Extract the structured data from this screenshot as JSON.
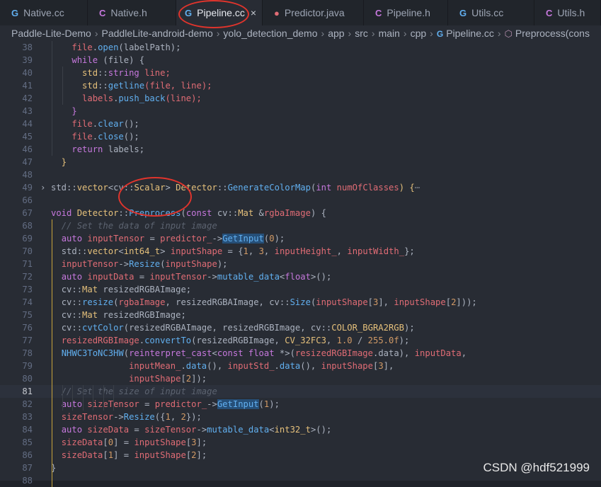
{
  "tabs": [
    {
      "label": "Native.cc",
      "icon": "G",
      "icon_color": "#61afef"
    },
    {
      "label": "Native.h",
      "icon": "C",
      "icon_color": "#c678dd"
    },
    {
      "label": "Pipeline.cc",
      "icon": "G",
      "icon_color": "#61afef",
      "close": "×"
    },
    {
      "label": "Predictor.java",
      "icon": "●",
      "icon_color": "#e06c75"
    },
    {
      "label": "Pipeline.h",
      "icon": "C",
      "icon_color": "#c678dd"
    },
    {
      "label": "Utils.cc",
      "icon": "G",
      "icon_color": "#61afef"
    },
    {
      "label": "Utils.h",
      "icon": "C",
      "icon_color": "#c678dd"
    }
  ],
  "breadcrumb": [
    "Paddle-Lite-Demo",
    "PaddleLite-android-demo",
    "yolo_detection_demo",
    "app",
    "src",
    "main",
    "cpp",
    "Pipeline.cc",
    "Preprocess(cons"
  ],
  "code_lines": [
    {
      "num": "38",
      "tokens": [
        [
          "    ",
          ""
        ],
        [
          "file",
          "v"
        ],
        [
          ".",
          "p"
        ],
        [
          "open",
          "f"
        ],
        [
          "(labelPath);",
          "p"
        ]
      ]
    },
    {
      "num": "39",
      "tokens": [
        [
          "    ",
          ""
        ],
        [
          "while",
          "k"
        ],
        [
          " (file) {",
          "p"
        ]
      ]
    },
    {
      "num": "40",
      "tokens": [
        [
          "      ",
          ""
        ],
        [
          "std",
          "t"
        ],
        [
          "::",
          "p"
        ],
        [
          "string",
          "k"
        ],
        [
          " line;",
          "v"
        ]
      ]
    },
    {
      "num": "41",
      "tokens": [
        [
          "      ",
          ""
        ],
        [
          "std",
          "t"
        ],
        [
          "::",
          "p"
        ],
        [
          "getline",
          "f"
        ],
        [
          "(file, line);",
          "v"
        ]
      ]
    },
    {
      "num": "42",
      "tokens": [
        [
          "      ",
          ""
        ],
        [
          "labels",
          "v"
        ],
        [
          ".",
          "p"
        ],
        [
          "push_back",
          "f"
        ],
        [
          "(line);",
          "v"
        ]
      ]
    },
    {
      "num": "43",
      "tokens": [
        [
          "    ",
          ""
        ],
        [
          "}",
          "k"
        ]
      ]
    },
    {
      "num": "44",
      "tokens": [
        [
          "    ",
          ""
        ],
        [
          "file",
          "v"
        ],
        [
          ".",
          "p"
        ],
        [
          "clear",
          "f"
        ],
        [
          "();",
          "p"
        ]
      ]
    },
    {
      "num": "45",
      "tokens": [
        [
          "    ",
          ""
        ],
        [
          "file",
          "v"
        ],
        [
          ".",
          "p"
        ],
        [
          "close",
          "f"
        ],
        [
          "();",
          "p"
        ]
      ]
    },
    {
      "num": "46",
      "tokens": [
        [
          "    ",
          ""
        ],
        [
          "return",
          "k"
        ],
        [
          " labels;",
          "p"
        ]
      ]
    },
    {
      "num": "47",
      "tokens": [
        [
          "  ",
          ""
        ],
        [
          "}",
          "t"
        ]
      ]
    },
    {
      "num": "48",
      "tokens": []
    },
    {
      "num": "49",
      "fold": "›",
      "tokens": [
        [
          "std",
          "p"
        ],
        [
          "::",
          "p"
        ],
        [
          "vector",
          "t"
        ],
        [
          "<",
          "p"
        ],
        [
          "cv",
          "p"
        ],
        [
          "::",
          "p"
        ],
        [
          "Scalar",
          "t"
        ],
        [
          "> ",
          "p"
        ],
        [
          "Detector",
          "t"
        ],
        [
          "::",
          "p"
        ],
        [
          "GenerateColorMap",
          "f"
        ],
        [
          "(",
          "p"
        ],
        [
          "int",
          "k"
        ],
        [
          " ",
          "p"
        ],
        [
          "numOfClasses",
          "v"
        ],
        [
          ") {",
          "t"
        ],
        [
          "⋯",
          "collapsed"
        ]
      ]
    },
    {
      "num": "66",
      "tokens": []
    },
    {
      "num": "67",
      "tokens": [
        [
          "void",
          "k"
        ],
        [
          " ",
          "p"
        ],
        [
          "Detector",
          "t"
        ],
        [
          "::",
          "p"
        ],
        [
          "Preprocess",
          "f"
        ],
        [
          "(",
          "p"
        ],
        [
          "const",
          "k"
        ],
        [
          " cv::",
          "p"
        ],
        [
          "Mat",
          "t"
        ],
        [
          " &",
          "p"
        ],
        [
          "rgbaImage",
          "v"
        ],
        [
          ") {",
          "p"
        ]
      ]
    },
    {
      "num": "68",
      "tokens": [
        [
          "  ",
          ""
        ],
        [
          "// Set the data of input image",
          "c"
        ]
      ]
    },
    {
      "num": "69",
      "tokens": [
        [
          "  ",
          ""
        ],
        [
          "auto",
          "k"
        ],
        [
          " ",
          "p"
        ],
        [
          "inputTensor",
          "v"
        ],
        [
          " = ",
          "p"
        ],
        [
          "predictor_",
          "v"
        ],
        [
          "->",
          "p"
        ],
        [
          "GetInput",
          "f"
        ],
        [
          "(",
          "p"
        ],
        [
          "0",
          "n"
        ],
        [
          ");",
          "p"
        ]
      ]
    },
    {
      "num": "70",
      "tokens": [
        [
          "  ",
          ""
        ],
        [
          "std::",
          "p"
        ],
        [
          "vector",
          "t"
        ],
        [
          "<",
          "p"
        ],
        [
          "int64_t",
          "t"
        ],
        [
          "> ",
          "p"
        ],
        [
          "inputShape",
          "v"
        ],
        [
          " = {",
          "p"
        ],
        [
          "1",
          "n"
        ],
        [
          ", ",
          "p"
        ],
        [
          "3",
          "n"
        ],
        [
          ", ",
          "p"
        ],
        [
          "inputHeight_",
          "v"
        ],
        [
          ", ",
          "p"
        ],
        [
          "inputWidth_",
          "v"
        ],
        [
          "};",
          "p"
        ]
      ]
    },
    {
      "num": "71",
      "tokens": [
        [
          "  ",
          ""
        ],
        [
          "inputTensor",
          "v"
        ],
        [
          "->",
          "p"
        ],
        [
          "Resize",
          "f"
        ],
        [
          "(",
          "p"
        ],
        [
          "inputShape",
          "v"
        ],
        [
          ");",
          "p"
        ]
      ]
    },
    {
      "num": "72",
      "tokens": [
        [
          "  ",
          ""
        ],
        [
          "auto",
          "k"
        ],
        [
          " ",
          "p"
        ],
        [
          "inputData",
          "v"
        ],
        [
          " = ",
          "p"
        ],
        [
          "inputTensor",
          "v"
        ],
        [
          "->",
          "p"
        ],
        [
          "mutable_data",
          "f"
        ],
        [
          "<",
          "p"
        ],
        [
          "float",
          "k"
        ],
        [
          ">();",
          "p"
        ]
      ]
    },
    {
      "num": "73",
      "tokens": [
        [
          "  ",
          ""
        ],
        [
          "cv::",
          "p"
        ],
        [
          "Mat",
          "t"
        ],
        [
          " resizedRGBAImage;",
          "p"
        ]
      ]
    },
    {
      "num": "74",
      "tokens": [
        [
          "  ",
          ""
        ],
        [
          "cv::",
          "p"
        ],
        [
          "resize",
          "f"
        ],
        [
          "(",
          "p"
        ],
        [
          "rgbaImage",
          "v"
        ],
        [
          ", resizedRGBAImage, cv::",
          "p"
        ],
        [
          "Size",
          "f"
        ],
        [
          "(",
          "p"
        ],
        [
          "inputShape",
          "v"
        ],
        [
          "[",
          "p"
        ],
        [
          "3",
          "n"
        ],
        [
          "], ",
          "p"
        ],
        [
          "inputShape",
          "v"
        ],
        [
          "[",
          "p"
        ],
        [
          "2",
          "n"
        ],
        [
          "]));",
          "p"
        ]
      ]
    },
    {
      "num": "75",
      "tokens": [
        [
          "  ",
          ""
        ],
        [
          "cv::",
          "p"
        ],
        [
          "Mat",
          "t"
        ],
        [
          " resizedRGBImage;",
          "p"
        ]
      ]
    },
    {
      "num": "76",
      "tokens": [
        [
          "  ",
          ""
        ],
        [
          "cv::",
          "p"
        ],
        [
          "cvtColor",
          "f"
        ],
        [
          "(resizedRGBAImage, resizedRGBImage, cv::",
          "p"
        ],
        [
          "COLOR_BGRA2RGB",
          "t"
        ],
        [
          ");",
          "p"
        ]
      ]
    },
    {
      "num": "77",
      "tokens": [
        [
          "  ",
          ""
        ],
        [
          "resizedRGBImage",
          "v"
        ],
        [
          ".",
          "p"
        ],
        [
          "convertTo",
          "f"
        ],
        [
          "(resizedRGBImage, ",
          "p"
        ],
        [
          "CV_32FC3",
          "t"
        ],
        [
          ", ",
          "p"
        ],
        [
          "1.0",
          "n"
        ],
        [
          " / ",
          "p"
        ],
        [
          "255.0f",
          "n"
        ],
        [
          ");",
          "p"
        ]
      ]
    },
    {
      "num": "78",
      "tokens": [
        [
          "  ",
          ""
        ],
        [
          "NHWC3ToNC3HW",
          "f"
        ],
        [
          "(",
          "p"
        ],
        [
          "reinterpret_cast",
          "k"
        ],
        [
          "<",
          "p"
        ],
        [
          "const",
          "k"
        ],
        [
          " ",
          "p"
        ],
        [
          "float",
          "k"
        ],
        [
          " *>(",
          "p"
        ],
        [
          "resizedRGBImage",
          "v"
        ],
        [
          ".data), ",
          "p"
        ],
        [
          "inputData",
          "v"
        ],
        [
          ",",
          "p"
        ]
      ]
    },
    {
      "num": "79",
      "tokens": [
        [
          "               ",
          ""
        ],
        [
          "inputMean_",
          "v"
        ],
        [
          ".",
          "p"
        ],
        [
          "data",
          "f"
        ],
        [
          "(), ",
          "p"
        ],
        [
          "inputStd_",
          "v"
        ],
        [
          ".",
          "p"
        ],
        [
          "data",
          "f"
        ],
        [
          "(), ",
          "p"
        ],
        [
          "inputShape",
          "v"
        ],
        [
          "[",
          "p"
        ],
        [
          "3",
          "n"
        ],
        [
          "],",
          "p"
        ]
      ]
    },
    {
      "num": "80",
      "tokens": [
        [
          "               ",
          ""
        ],
        [
          "inputShape",
          "v"
        ],
        [
          "[",
          "p"
        ],
        [
          "2",
          "n"
        ],
        [
          "]);",
          "p"
        ]
      ]
    },
    {
      "num": "81",
      "current": true,
      "tokens": [
        [
          "  ",
          ""
        ],
        [
          "// Set the size of input image",
          "c"
        ]
      ]
    },
    {
      "num": "82",
      "tokens": [
        [
          "  ",
          ""
        ],
        [
          "auto",
          "k"
        ],
        [
          " ",
          "p"
        ],
        [
          "sizeTensor",
          "v"
        ],
        [
          " = ",
          "p"
        ],
        [
          "predictor_",
          "v"
        ],
        [
          "->",
          "p"
        ],
        [
          "GetInput",
          "f"
        ],
        [
          "(",
          "p"
        ],
        [
          "1",
          "n"
        ],
        [
          ");",
          "p"
        ]
      ]
    },
    {
      "num": "83",
      "tokens": [
        [
          "  ",
          ""
        ],
        [
          "sizeTensor",
          "v"
        ],
        [
          "->",
          "p"
        ],
        [
          "Resize",
          "f"
        ],
        [
          "({",
          "p"
        ],
        [
          "1",
          "n"
        ],
        [
          ", ",
          "p"
        ],
        [
          "2",
          "n"
        ],
        [
          "});",
          "p"
        ]
      ]
    },
    {
      "num": "84",
      "tokens": [
        [
          "  ",
          ""
        ],
        [
          "auto",
          "k"
        ],
        [
          " ",
          "p"
        ],
        [
          "sizeData",
          "v"
        ],
        [
          " = ",
          "p"
        ],
        [
          "sizeTensor",
          "v"
        ],
        [
          "->",
          "p"
        ],
        [
          "mutable_data",
          "f"
        ],
        [
          "<",
          "p"
        ],
        [
          "int32_t",
          "t"
        ],
        [
          ">();",
          "p"
        ]
      ]
    },
    {
      "num": "85",
      "tokens": [
        [
          "  ",
          ""
        ],
        [
          "sizeData",
          "v"
        ],
        [
          "[",
          "p"
        ],
        [
          "0",
          "n"
        ],
        [
          "] = ",
          "p"
        ],
        [
          "inputShape",
          "v"
        ],
        [
          "[",
          "p"
        ],
        [
          "3",
          "n"
        ],
        [
          "];",
          "p"
        ]
      ]
    },
    {
      "num": "86",
      "tokens": [
        [
          "  ",
          ""
        ],
        [
          "sizeData",
          "v"
        ],
        [
          "[",
          "p"
        ],
        [
          "1",
          "n"
        ],
        [
          "] = ",
          "p"
        ],
        [
          "inputShape",
          "v"
        ],
        [
          "[",
          "p"
        ],
        [
          "2",
          "n"
        ],
        [
          "];",
          "p"
        ]
      ]
    },
    {
      "num": "87",
      "tokens": [
        [
          "}",
          "p"
        ]
      ]
    },
    {
      "num": "88",
      "tokens": []
    }
  ],
  "watermark": "CSDN @hdf521999"
}
